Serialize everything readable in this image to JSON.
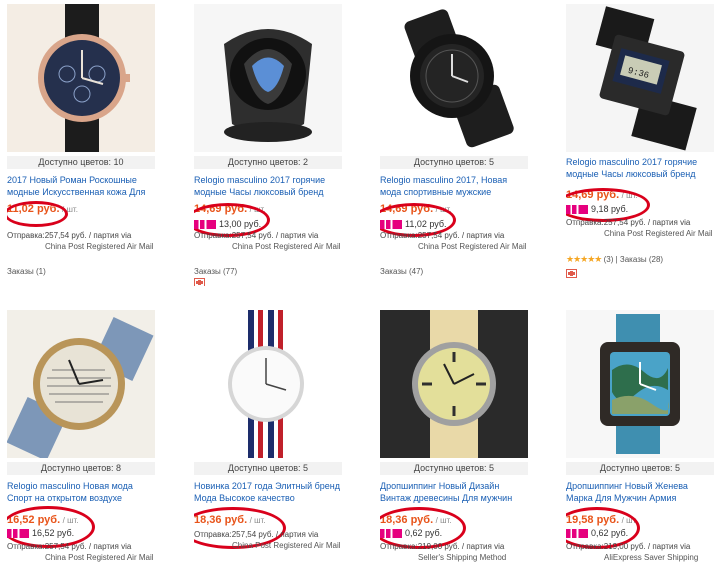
{
  "products": [
    {
      "colors": "Доступно цветов: 10",
      "title": "2017 Новый Роман Роскошные модные Искусственная кожа Для",
      "price": "11,02 руб.",
      "unit": "/ шт.",
      "sale": "",
      "shipping": "Отправка:257,54 руб. / партия via",
      "method": "China Post Registered Air Mail",
      "orders": "Заказы (1)",
      "rating": ""
    },
    {
      "colors": "Доступно цветов: 2",
      "title": "Relogio masculino 2017 горячие модные Часы люксовый бренд",
      "price": "14,69 руб.",
      "unit": "/ шт.",
      "sale": "13,00 руб.",
      "shipping": "Отправка:257,54 руб. / партия via",
      "method": "China Post Registered Air Mail",
      "orders": "Заказы (77)",
      "rating": ""
    },
    {
      "colors": "Доступно цветов: 5",
      "title": "Relogio masculino 2017, Новая мода спортивные мужские",
      "price": "14,69 руб.",
      "unit": "/ шт.",
      "sale": "11,02 руб.",
      "shipping": "Отправка:257,54 руб. / партия via",
      "method": "China Post Registered Air Mail",
      "orders": "Заказы (47)",
      "rating": ""
    },
    {
      "colors": "",
      "title": "Relogio masculino 2017 горячие модные Часы люксовый бренд",
      "price": "14,69 руб.",
      "unit": "/ шт.",
      "sale": "9,18 руб.",
      "shipping": "Отправка:257,54 руб. / партия via",
      "method": "China Post Registered Air Mail",
      "orders": "(3)  |  Заказы (28)",
      "rating": "★★★★★"
    },
    {
      "colors": "Доступно цветов: 8",
      "title": "Relogio masculino Новая мода Спорт на открытом воздухе",
      "price": "16,52 руб.",
      "unit": "/ шт.",
      "sale": "16,52 руб.",
      "shipping": "Отправка:257,54 руб. / партия via",
      "method": "China Post Registered Air Mail",
      "orders": "",
      "rating": ""
    },
    {
      "colors": "Доступно цветов: 5",
      "title": "Новинка 2017 года Элитный бренд Мода Высокое качество",
      "price": "18,36 руб.",
      "unit": "/ шт.",
      "sale": "",
      "shipping": "Отправка:257,54 руб. / партия via",
      "method": "China Post Registered Air Mail",
      "orders": "",
      "rating": ""
    },
    {
      "colors": "Доступно цветов: 5",
      "title": "Дропшиппинг Новый Дизайн Винтаж древесины Для мужчин",
      "price": "18,36 руб.",
      "unit": "/ шт.",
      "sale": "0,62 руб.",
      "shipping": "Отправка:219,00 руб. / партия via",
      "method": "Seller's Shipping Method",
      "orders": "",
      "rating": ""
    },
    {
      "colors": "Доступно цветов: 5",
      "title": "Дропшиппинг Новый Женева Марка Для Мужчин Армия",
      "price": "19,58 руб.",
      "unit": "/ шт.",
      "sale": "0,62 руб.",
      "shipping": "Отправка:219,00 руб. / партия via",
      "method": "AliExpress Saver Shipping",
      "orders": "",
      "rating": ""
    }
  ],
  "colors": {
    "accent_price": "#e8541a",
    "circle": "#d9001b",
    "title_link": "#1a5fb4"
  }
}
